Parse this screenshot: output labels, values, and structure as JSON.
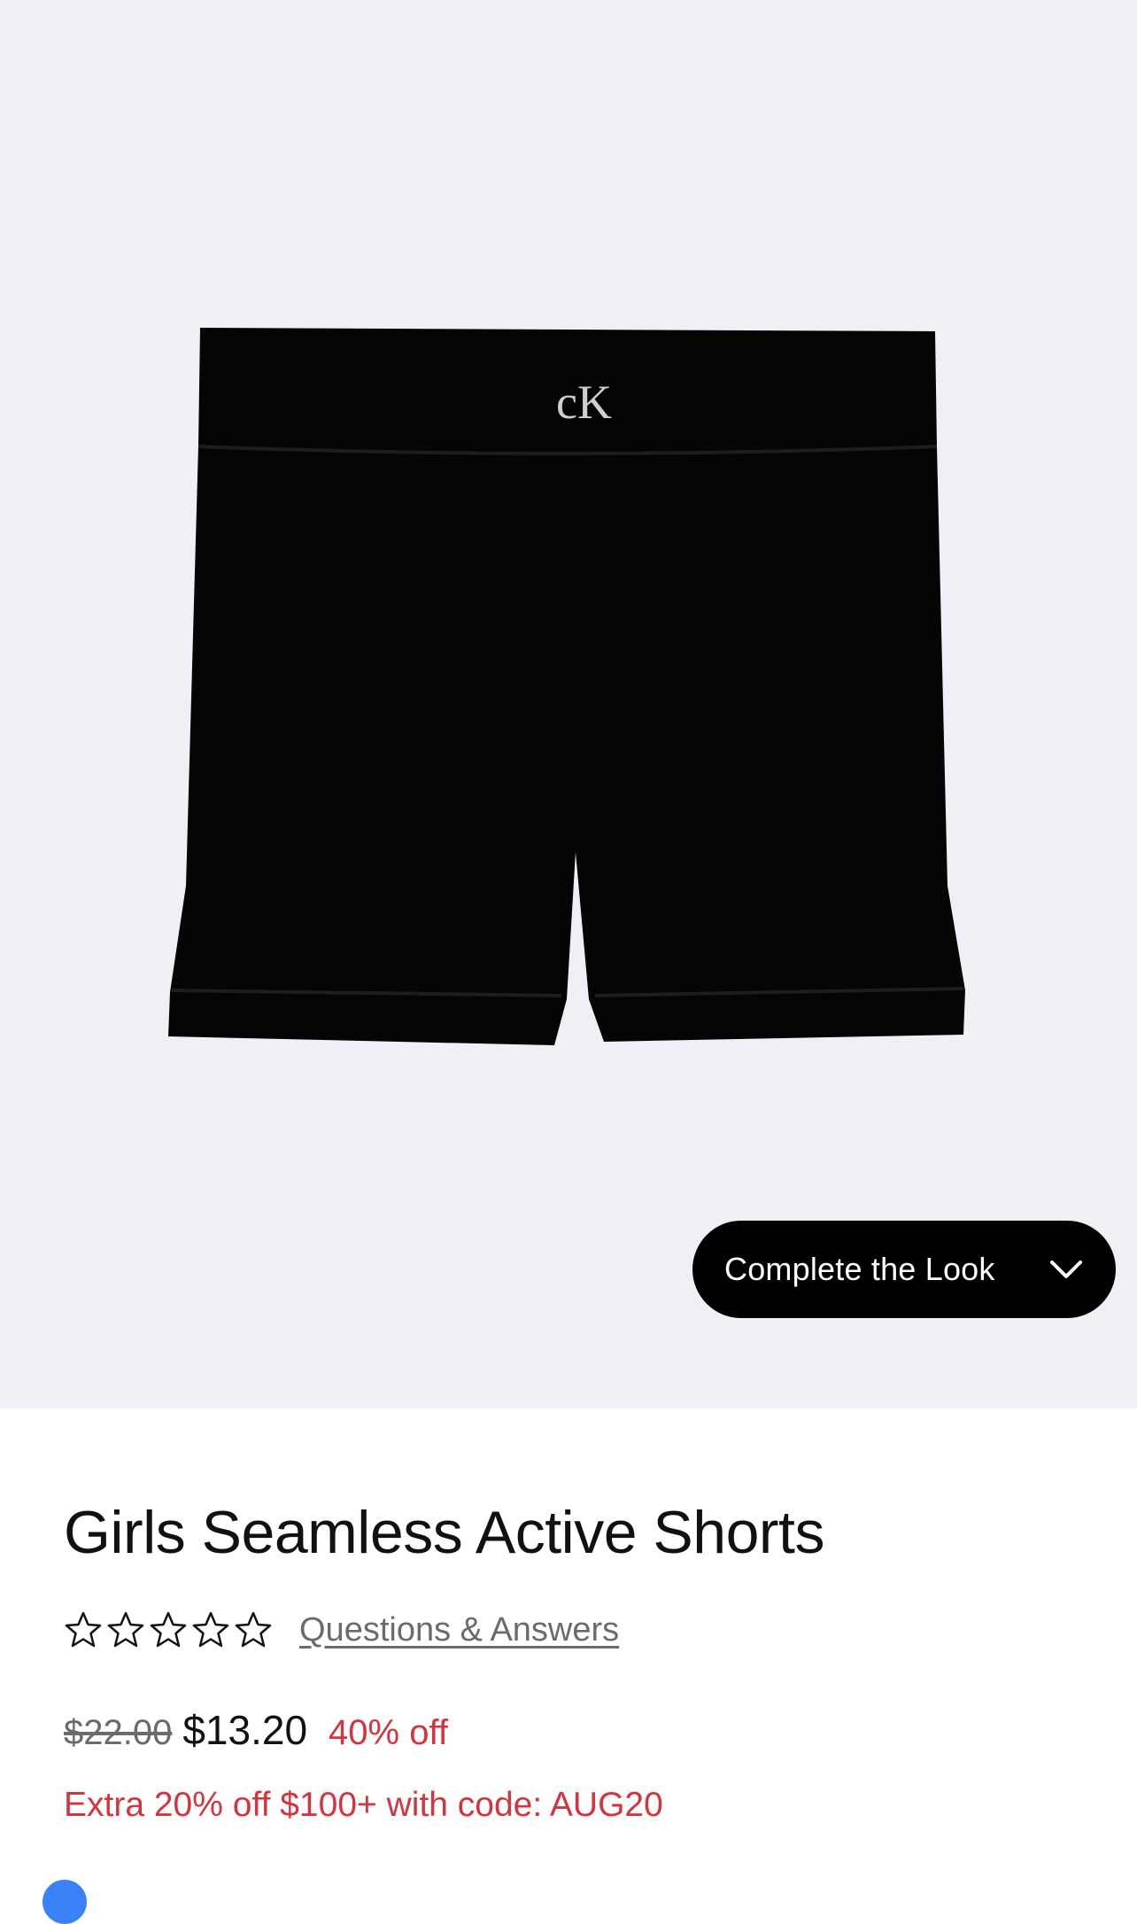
{
  "product": {
    "image_alt": "Black seamless shorts with CK logo",
    "logo_text": "cK",
    "title": "Girls Seamless Active Shorts",
    "rating": {
      "stars_filled": 0,
      "stars_total": 5
    },
    "qa_link": "Questions & Answers",
    "original_price": "$22.00",
    "sale_price": "$13.20",
    "discount": "40% off",
    "promo": "Extra 20% off $100+ with code: AUG20"
  },
  "complete_look": {
    "label": "Complete the Look",
    "icon": "chevron-down-icon"
  },
  "colors": {
    "hero_bg": "#eff0f5",
    "sale_red": "#d5333d",
    "button_bg": "#000000"
  }
}
